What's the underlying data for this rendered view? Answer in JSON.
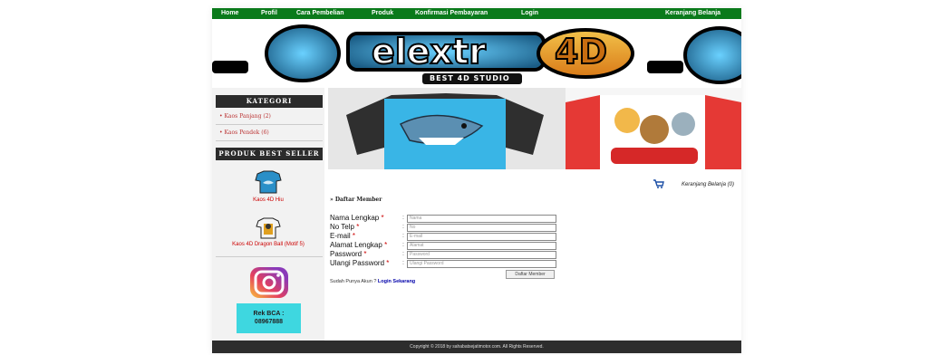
{
  "nav": {
    "items": [
      {
        "label": "Home"
      },
      {
        "label": "Profil"
      },
      {
        "label": "Cara Pembelian"
      },
      {
        "label": "Produk"
      },
      {
        "label": "Konfirmasi Pembayaran"
      },
      {
        "label": "Login"
      }
    ],
    "cart_label": "Keranjang Belanja"
  },
  "banner": {
    "brand_text": "elextr",
    "brand_suffix": "4D",
    "tagline": "BEST 4D STUDIO"
  },
  "sidebar": {
    "kategori_title": "KATEGORI",
    "kategori_items": [
      {
        "label": "Kaos Panjang (2)"
      },
      {
        "label": "Kaos Pendek (6)"
      }
    ],
    "best_seller_title": "PRODUK BEST SELLER",
    "products": [
      {
        "name": "Kaos 4D Hiu"
      },
      {
        "name": "Kaos 4D Dragon Ball (Motif 5)"
      }
    ],
    "rek_label": "Rek BCA :",
    "rek_number": "08967888"
  },
  "main": {
    "cart_link": "Keranjang Belanja (0)",
    "section_title": "» Daftar Member",
    "form": {
      "fields": [
        {
          "label": "Nama Lengkap",
          "required": "*",
          "placeholder": "Nama"
        },
        {
          "label": "No Telp",
          "required": "*",
          "placeholder": "No"
        },
        {
          "label": "E-mail",
          "required": "*",
          "placeholder": "E-mail"
        },
        {
          "label": "Alamat Lengkap",
          "required": "*",
          "placeholder": "Alamat"
        },
        {
          "label": "Password",
          "required": "*",
          "placeholder": "Password"
        },
        {
          "label": "Ulangi Password",
          "required": "*",
          "placeholder": "Ulangi Password"
        }
      ],
      "submit_label": "Daftar Member",
      "login_prompt": "Sudah Punya Akun ?",
      "login_link": "Login Sekarang"
    }
  },
  "footer": {
    "text": "Copyright © 2018 by sahabatsejatimotor.com. All Rights Reserved."
  },
  "colors": {
    "nav_bg": "#0a7a1b",
    "sidebar_head": "#2b2b2b",
    "footer_bg": "#2d2d2d",
    "accent_red": "#c00000",
    "rek_box": "#3ed7e0"
  }
}
